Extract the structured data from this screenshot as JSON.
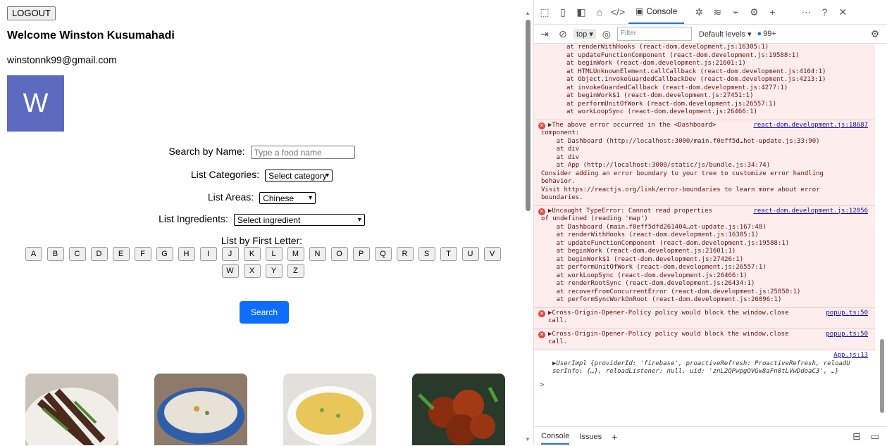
{
  "app": {
    "logout_label": "LOGOUT",
    "welcome": "Welcome Winston Kusumahadi",
    "email": "winstonnk99@gmail.com",
    "avatar_letter": "W",
    "avatar_color": "#5c6bc0",
    "search_name_label": "Search by Name:",
    "search_name_placeholder": "Type a food name",
    "categories_label": "List Categories:",
    "categories_value": "Select category",
    "areas_label": "List Areas:",
    "areas_value": "Chinese",
    "ingredients_label": "List Ingredients:",
    "ingredients_value": "Select ingredient",
    "letters_label": "List by First Letter:",
    "letters": [
      "A",
      "B",
      "C",
      "D",
      "E",
      "F",
      "G",
      "H",
      "I",
      "J",
      "K",
      "L",
      "M",
      "N",
      "O",
      "P",
      "Q",
      "R",
      "S",
      "T",
      "U",
      "V",
      "W",
      "X",
      "Y",
      "Z"
    ],
    "search_button": "Search",
    "search_button_color": "#0d6efd"
  },
  "devtools": {
    "tab_console": "Console",
    "context": "top",
    "filter_placeholder": "Filter",
    "levels": "Default levels",
    "issues_count": "99+",
    "bottom_console": "Console",
    "bottom_issues": "Issues",
    "log": {
      "e1_lines": [
        "at renderWithHooks (react-dom.development.js:16305:1)",
        "at updateFunctionComponent (react-dom.development.js:19588:1)",
        "at beginWork (react-dom.development.js:21601:1)",
        "at HTMLUnknownElement.callCallback (react-dom.development.js:4164:1)",
        "at Object.invokeGuardedCallbackDev (react-dom.development.js:4213:1)",
        "at invokeGuardedCallback (react-dom.development.js:4277:1)",
        "at beginWork$1 (react-dom.development.js:27451:1)",
        "at performUnitOfWork (react-dom.development.js:26557:1)",
        "at workLoopSync (react-dom.development.js:26466:1)"
      ],
      "e2_head": "▶The above error occurred in the <Dashboard>",
      "e2_src": "react-dom.development.js:18687",
      "e2_lines": [
        "component:",
        "",
        "    at Dashboard (http://localhost:3000/main.f0eff5d…hot-update.js:33:90)",
        "    at div",
        "    at div",
        "    at App (http://localhost:3000/static/js/bundle.js:34:74)",
        "",
        "Consider adding an error boundary to your tree to customize error handling",
        "behavior.",
        "Visit https://reactjs.org/link/error-boundaries to learn more about error",
        "boundaries."
      ],
      "e3_head": "▶Uncaught TypeError: Cannot read properties",
      "e3_src": "react-dom.development.js:12056",
      "e3_lines": [
        "of undefined (reading 'map')",
        "    at Dashboard (main.f0eff5dfd261404…ot-update.js:167:48)",
        "    at renderWithHooks (react-dom.development.js:16305:1)",
        "    at updateFunctionComponent (react-dom.development.js:19588:1)",
        "    at beginWork (react-dom.development.js:21601:1)",
        "    at beginWork$1 (react-dom.development.js:27426:1)",
        "    at performUnitOfWork (react-dom.development.js:26557:1)",
        "    at workLoopSync (react-dom.development.js:26466:1)",
        "    at renderRootSync (react-dom.development.js:26434:1)",
        "    at recoverFromConcurrentError (react-dom.development.js:25850:1)",
        "    at performSyncWorkOnRoot (react-dom.development.js:26096:1)"
      ],
      "e4_head": "▶Cross-Origin-Opener-Policy policy would block the window.close",
      "e4_src": "popup.ts:50",
      "e4_tail": "call.",
      "e5_head": "▶Cross-Origin-Opener-Policy policy would block the window.close",
      "e5_src": "popup.ts:50",
      "e5_tail": "call.",
      "info_src": "App.js:13",
      "info_line1": "▶UserImpl {providerId: 'firebase', proactiveRefresh: ProactiveRefresh, reloadU",
      "info_line2": "serInfo: {…}, reloadListener: null, uid: 'znL2QPwpgOVGw8aFn0tLVwDdoaC3', …}",
      "prompt": ">"
    }
  }
}
